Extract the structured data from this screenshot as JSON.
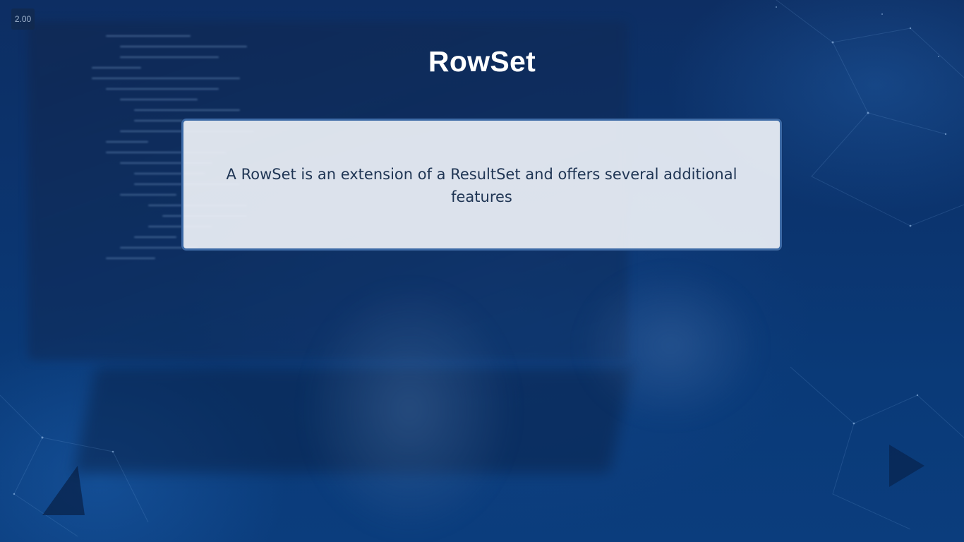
{
  "player": {
    "speed_label": "2.00"
  },
  "slide": {
    "title": "RowSet",
    "body_text": "A RowSet is an extension of a ResultSet and offers several additional features"
  },
  "colors": {
    "background": "#0b3570",
    "title_text": "#ffffff",
    "box_fill": "#eceff6",
    "box_border": "#3c6aa6",
    "body_text": "#1f3554"
  }
}
